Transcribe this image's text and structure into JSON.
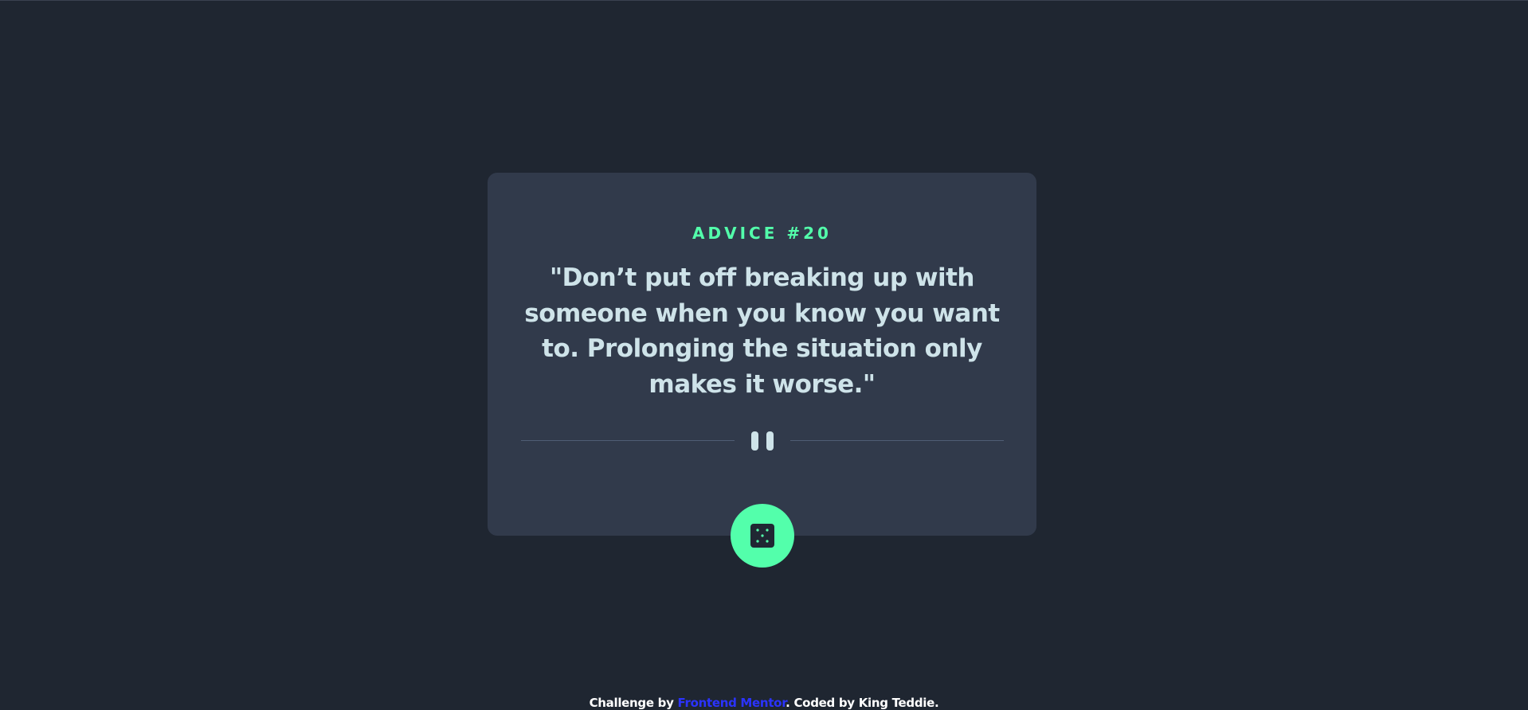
{
  "card": {
    "advice_number": "ADVICE #20",
    "quote": "\"Don’t put off breaking up with someone when you know you want to. Prolonging the situation only makes it worse.\""
  },
  "divider": {
    "icon": "pause-icon"
  },
  "dice_button": {
    "icon": "dice-icon"
  },
  "footer": {
    "prefix": "Challenge by ",
    "link_text": "Frontend Mentor",
    "middle": ". Coded by ",
    "author": "King Teddie",
    "suffix": "."
  },
  "colors": {
    "background": "#1f2631",
    "card": "#313a4b",
    "accent": "#53ffab",
    "text": "#cee3e9",
    "divider": "#4f5d74",
    "link": "#2b33ff"
  }
}
